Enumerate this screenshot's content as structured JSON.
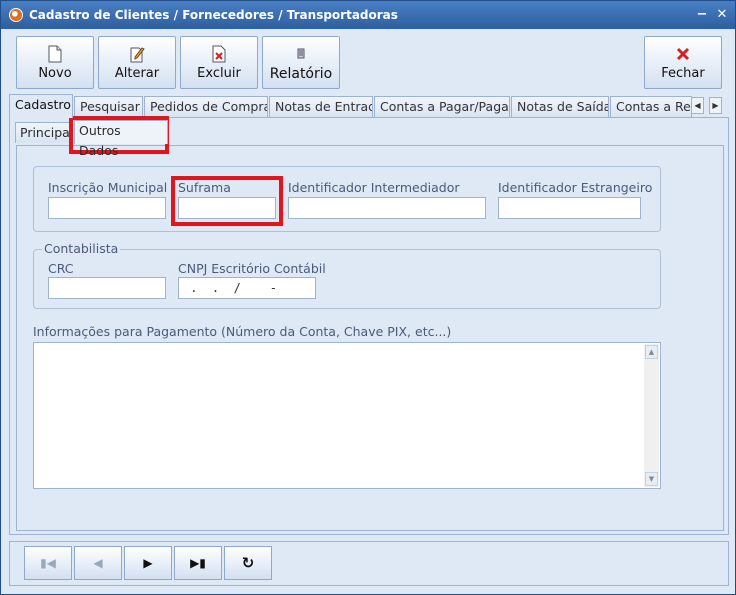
{
  "window": {
    "title": "Cadastro de Clientes / Fornecedores / Transportadoras"
  },
  "toolbar": {
    "novo_label": "Novo",
    "alterar_label": "Alterar",
    "excluir_label": "Excluir",
    "relatorio_label": "Relatório",
    "fechar_label": "Fechar"
  },
  "main_tabs": [
    "Cadastro",
    "Pesquisar",
    "Pedidos de Compra",
    "Notas de Entrada",
    "Contas a Pagar/Pagas",
    "Notas de Saída",
    "Contas a Rec"
  ],
  "sub_tabs": [
    "Principal",
    "Outros Dados"
  ],
  "fields": {
    "inscricao_municipal": "Inscrição Municipal",
    "suframa": "Suframa",
    "identificador_intermediador": "Identificador Intermediador",
    "identificador_estrangeiro": "Identificador Estrangeiro"
  },
  "contabilista": {
    "legend": "Contabilista",
    "crc": "CRC",
    "cnpj": "CNPJ Escritório Contábil",
    "cnpj_mask": " .  .  /    -"
  },
  "pagamento": {
    "label": "Informações para Pagamento (Número da Conta, Chave PIX, etc...)"
  },
  "icons": {
    "app": "app-icon",
    "minimize": "minimize-icon",
    "close": "close-icon",
    "novo": "new-document-icon",
    "alterar": "edit-icon",
    "excluir": "delete-document-icon",
    "relatorio": "report-icon",
    "fechar": "red-x-icon",
    "first": "first-record-icon",
    "prev": "previous-record-icon",
    "next": "next-record-icon",
    "last": "last-record-icon",
    "refresh": "refresh-icon"
  },
  "colors": {
    "highlight": "#e0151d",
    "close_red": "#d81e1e"
  }
}
